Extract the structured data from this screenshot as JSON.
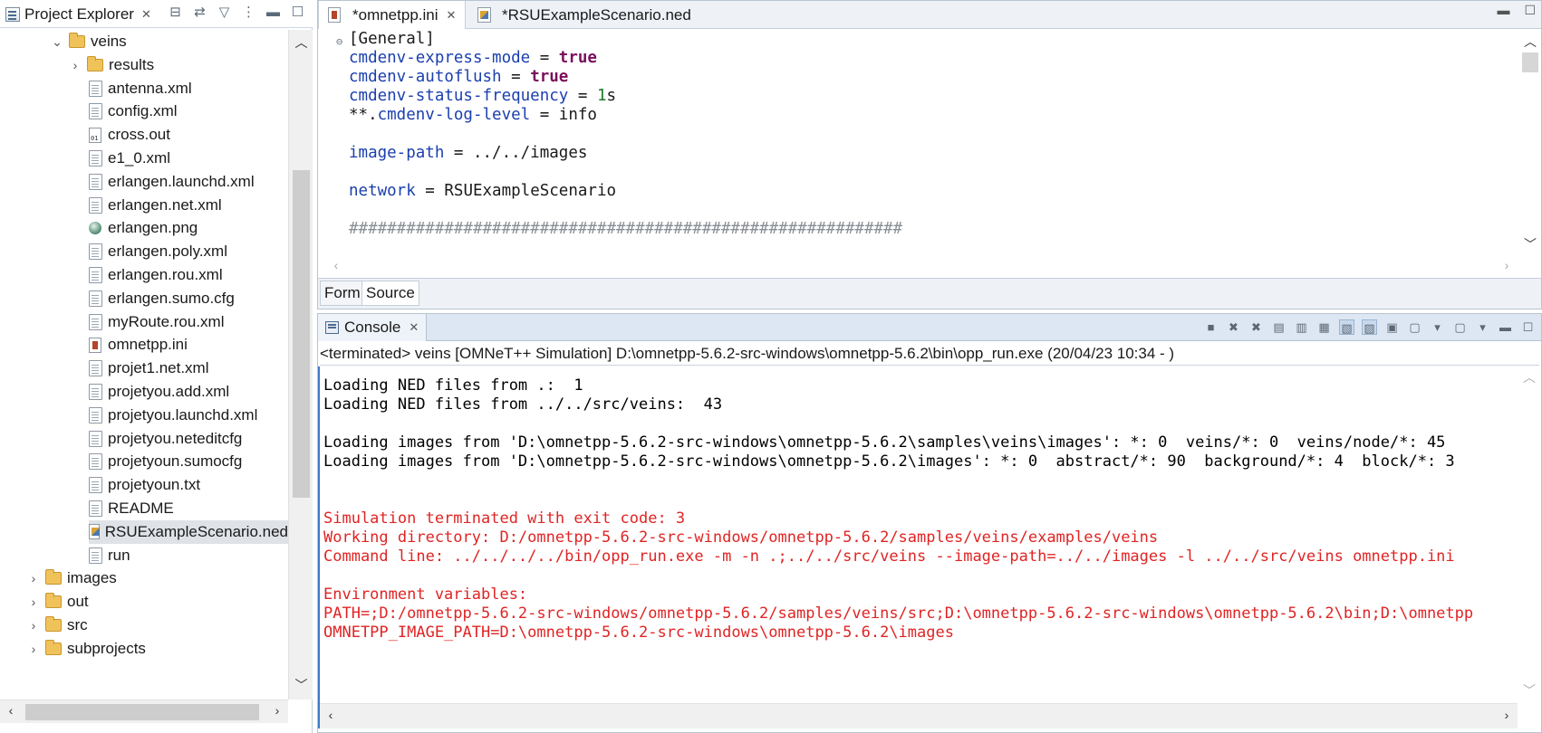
{
  "project_explorer": {
    "tab_label": "Project Explorer",
    "tree": [
      {
        "label": "veins",
        "type": "folder",
        "twisty": "⌄",
        "indent": 1
      },
      {
        "label": "results",
        "type": "folder",
        "twisty": "›",
        "indent": 2
      },
      {
        "label": "antenna.xml",
        "type": "file",
        "indent": 2
      },
      {
        "label": "config.xml",
        "type": "file",
        "indent": 2
      },
      {
        "label": "cross.out",
        "type": "out",
        "indent": 2
      },
      {
        "label": "e1_0.xml",
        "type": "file",
        "indent": 2
      },
      {
        "label": "erlangen.launchd.xml",
        "type": "file",
        "indent": 2
      },
      {
        "label": "erlangen.net.xml",
        "type": "file",
        "indent": 2
      },
      {
        "label": "erlangen.png",
        "type": "image",
        "indent": 2
      },
      {
        "label": "erlangen.poly.xml",
        "type": "file",
        "indent": 2
      },
      {
        "label": "erlangen.rou.xml",
        "type": "file",
        "indent": 2
      },
      {
        "label": "erlangen.sumo.cfg",
        "type": "file",
        "indent": 2
      },
      {
        "label": "myRoute.rou.xml",
        "type": "file",
        "indent": 2
      },
      {
        "label": "omnetpp.ini",
        "type": "ini",
        "indent": 2
      },
      {
        "label": "projet1.net.xml",
        "type": "file",
        "indent": 2
      },
      {
        "label": "projetyou.add.xml",
        "type": "file",
        "indent": 2
      },
      {
        "label": "projetyou.launchd.xml",
        "type": "file",
        "indent": 2
      },
      {
        "label": "projetyou.neteditcfg",
        "type": "file",
        "indent": 2
      },
      {
        "label": "projetyoun.sumocfg",
        "type": "file",
        "indent": 2
      },
      {
        "label": "projetyoun.txt",
        "type": "file",
        "indent": 2
      },
      {
        "label": "README",
        "type": "file",
        "indent": 2
      },
      {
        "label": "RSUExampleScenario.ned",
        "type": "ned",
        "indent": 2,
        "selected": true
      },
      {
        "label": "run",
        "type": "file",
        "indent": 2
      },
      {
        "label": "images",
        "type": "folder",
        "twisty": "›",
        "indent": 0
      },
      {
        "label": "out",
        "type": "folder",
        "twisty": "›",
        "indent": 0
      },
      {
        "label": "src",
        "type": "folder",
        "twisty": "›",
        "indent": 0
      },
      {
        "label": "subprojects",
        "type": "folder",
        "twisty": "›",
        "indent": 0
      }
    ]
  },
  "editor": {
    "tabs": [
      {
        "label": "*omnetpp.ini",
        "active": true
      },
      {
        "label": "*RSUExampleScenario.ned",
        "active": false
      }
    ],
    "code_lines": [
      [
        {
          "t": "[General]",
          "c": ""
        }
      ],
      [
        {
          "t": "cmdenv-express-mode",
          "c": "k"
        },
        {
          "t": " = ",
          "c": ""
        },
        {
          "t": "true",
          "c": "v"
        }
      ],
      [
        {
          "t": "cmdenv-autoflush",
          "c": "k"
        },
        {
          "t": " = ",
          "c": ""
        },
        {
          "t": "true",
          "c": "v"
        }
      ],
      [
        {
          "t": "cmdenv-status-frequency",
          "c": "k"
        },
        {
          "t": " = ",
          "c": ""
        },
        {
          "t": "1",
          "c": "n"
        },
        {
          "t": "s",
          "c": ""
        }
      ],
      [
        {
          "t": "**.",
          "c": ""
        },
        {
          "t": "cmdenv-log-level",
          "c": "k"
        },
        {
          "t": " = info",
          "c": ""
        }
      ],
      [
        {
          "t": "",
          "c": ""
        }
      ],
      [
        {
          "t": "image-path",
          "c": "k"
        },
        {
          "t": " = ../../images",
          "c": ""
        }
      ],
      [
        {
          "t": "",
          "c": ""
        }
      ],
      [
        {
          "t": "network",
          "c": "k"
        },
        {
          "t": " = RSUExampleScenario",
          "c": ""
        }
      ],
      [
        {
          "t": "",
          "c": ""
        }
      ],
      [
        {
          "t": "##########################################################",
          "c": "cmt"
        }
      ]
    ],
    "subtabs": {
      "form": "Form",
      "source": "Source"
    }
  },
  "console": {
    "tab_label": "Console",
    "description": "<terminated> veins [OMNeT++ Simulation] D:\\omnetpp-5.6.2-src-windows\\omnetpp-5.6.2\\bin\\opp_run.exe (20/04/23 10:34 - )",
    "lines": [
      {
        "text": "",
        "err": false
      },
      {
        "text": "Loading NED files from .:  1",
        "err": false
      },
      {
        "text": "Loading NED files from ../../src/veins:  43",
        "err": false
      },
      {
        "text": "",
        "err": false
      },
      {
        "text": "Loading images from 'D:\\omnetpp-5.6.2-src-windows\\omnetpp-5.6.2\\samples\\veins\\images': *: 0  veins/*: 0  veins/node/*: 45",
        "err": false
      },
      {
        "text": "Loading images from 'D:\\omnetpp-5.6.2-src-windows\\omnetpp-5.6.2\\images': *: 0  abstract/*: 90  background/*: 4  block/*: 3",
        "err": false
      },
      {
        "text": "",
        "err": false
      },
      {
        "text": "",
        "err": false
      },
      {
        "text": "Simulation terminated with exit code: 3",
        "err": true
      },
      {
        "text": "Working directory: D:/omnetpp-5.6.2-src-windows/omnetpp-5.6.2/samples/veins/examples/veins",
        "err": true
      },
      {
        "text": "Command line: ../../../../bin/opp_run.exe -m -n .;../../src/veins --image-path=../../images -l ../../src/veins omnetpp.ini",
        "err": true
      },
      {
        "text": "",
        "err": false
      },
      {
        "text": "Environment variables:",
        "err": true
      },
      {
        "text": "PATH=;D:/omnetpp-5.6.2-src-windows/omnetpp-5.6.2/samples/veins/src;D:\\omnetpp-5.6.2-src-windows\\omnetpp-5.6.2\\bin;D:\\omnetpp",
        "err": true
      },
      {
        "text": "OMNETPP_IMAGE_PATH=D:\\omnetpp-5.6.2-src-windows\\omnetpp-5.6.2\\images",
        "err": true
      }
    ]
  },
  "colors": {
    "keyword": "#1b3fae",
    "boolean": "#7a0f5c",
    "number": "#1c7a2a",
    "error_text": "#e02424",
    "selection": "#dfe3e8"
  }
}
